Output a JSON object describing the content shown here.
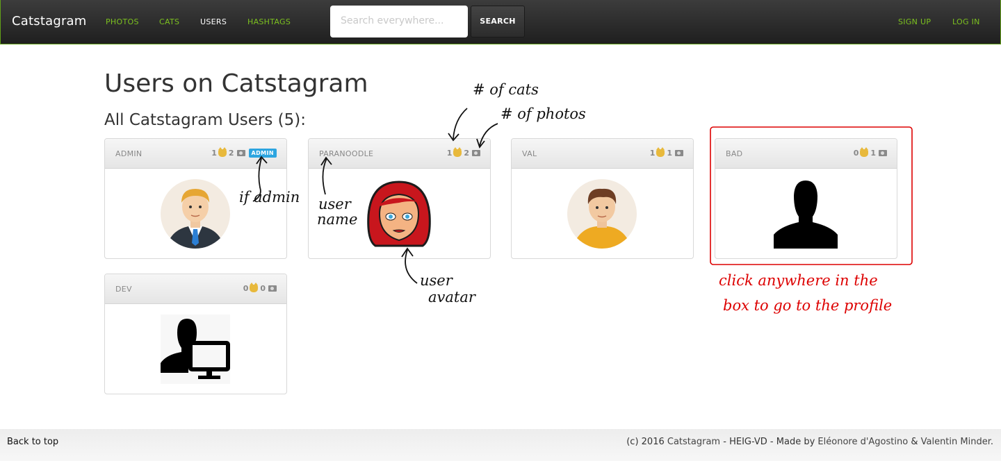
{
  "navbar": {
    "brand": "Catstagram",
    "links": [
      "PHOTOS",
      "CATS",
      "USERS",
      "HASHTAGS"
    ],
    "search_placeholder": "Search everywhere...",
    "search_button": "SEARCH",
    "sign_up": "SIGN UP",
    "log_in": "LOG IN"
  },
  "page": {
    "title": "Users on Catstagram",
    "subtitle": "All Catstagram Users (5):"
  },
  "users": [
    {
      "name": "ADMIN",
      "cats": "1",
      "photos": "2",
      "badge": "ADMIN",
      "avatar_icon": "male-admin-avatar"
    },
    {
      "name": "PARANOODLE",
      "cats": "1",
      "photos": "2",
      "avatar_icon": "red-hair-woman-avatar"
    },
    {
      "name": "VAL",
      "cats": "1",
      "photos": "1",
      "avatar_icon": "young-man-avatar"
    },
    {
      "name": "BAD",
      "cats": "0",
      "photos": "1",
      "avatar_icon": "default-silhouette-avatar"
    },
    {
      "name": "DEV",
      "cats": "0",
      "photos": "0",
      "avatar_icon": "developer-computer-avatar"
    }
  ],
  "annotations": {
    "num_cats": "# of cats",
    "num_photos": "# of photos",
    "if_admin": "if admin",
    "user_name_1": "user",
    "user_name_2": "name",
    "user_avatar_1": "user",
    "user_avatar_2": "avatar",
    "click_1": "click anywhere in the",
    "click_2": "box to go to the profile"
  },
  "footer": {
    "back_to_top": "Back to top",
    "prefix": "(c) 2016",
    "site": "Catstagram",
    "middle": "- HEIG-VD - Made by",
    "author1": "Eléonore d'Agostino",
    "amp": "&",
    "author2": "Valentin Minder",
    "end": "."
  },
  "colors": {
    "nav_link": "#7cc11f",
    "badge": "#2da5e0",
    "annotation_red": "#d00000"
  }
}
